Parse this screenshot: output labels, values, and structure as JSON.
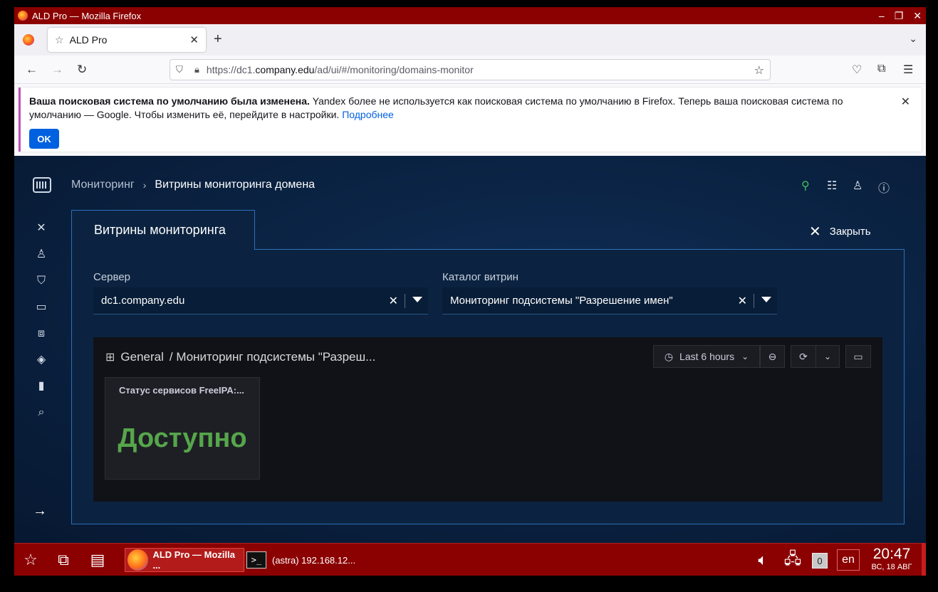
{
  "window": {
    "title": "ALD Pro — Mozilla Firefox",
    "controls": [
      "–",
      "❐",
      "✕"
    ]
  },
  "tabs": [
    {
      "label": "ALD Pro",
      "active": true
    }
  ],
  "newtab_label": "+",
  "url": {
    "prefix": "https://dc1.",
    "domain": "company.edu",
    "path": "/ad/ui/#/monitoring/domains-monitor"
  },
  "notification": {
    "bold": "Ваша поисковая система по умолчанию была изменена.",
    "text": " Yandex более не используется как поисковая система по умолчанию в Firefox. Теперь ваша поисковая система по умолчанию — Google. Чтобы изменить её, перейдите в настройки. ",
    "link": "Подробнее",
    "ok_label": "OK"
  },
  "app": {
    "breadcrumb": {
      "parent": "Мониторинг",
      "separator": "›",
      "current": "Витрины мониторинга домена"
    },
    "panel_title": "Витрины мониторинга",
    "close_label": "Закрыть",
    "server": {
      "label": "Сервер",
      "value": "dc1.company.edu"
    },
    "catalog": {
      "label": "Каталог витрин",
      "value": "Мониторинг подсистемы \"Разрешение имен\""
    },
    "grafana": {
      "folder": "General",
      "dashboard": "/ Мониторинг подсистемы \"Разреш...",
      "time_range": "Last 6 hours",
      "panel_title": "Статус сервисов FreeIPA:...",
      "panel_value": "Доступно",
      "value_color": "#56a64b"
    },
    "accent_color": "#2d6fb8"
  },
  "taskbar": {
    "firefox_label": "ALD Pro — Mozilla ...",
    "terminal_label": "(astra) 192.168.12...",
    "terminal_icon": ">_",
    "counter": "0",
    "lang": "en",
    "time": "20:47",
    "date": "ВС, 18 АВГ"
  }
}
